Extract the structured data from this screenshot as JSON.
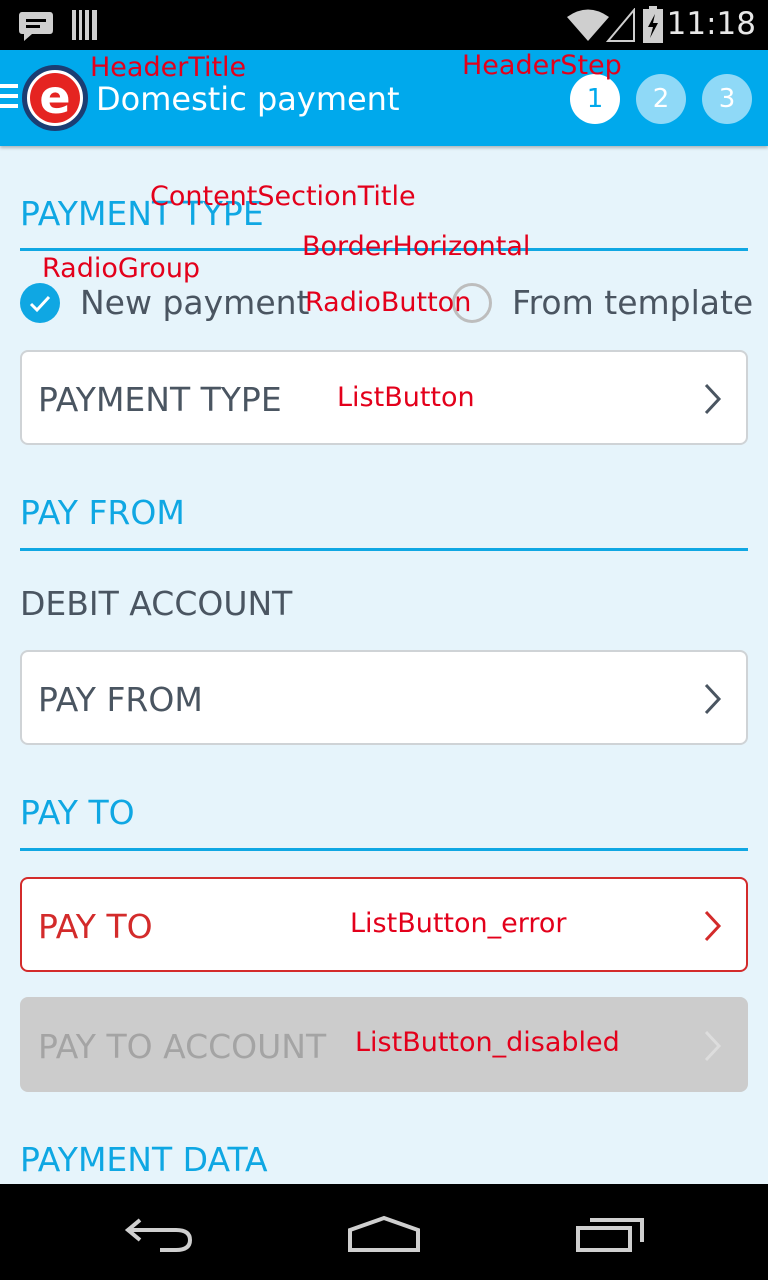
{
  "status_bar": {
    "time": "11:18",
    "icons": [
      "chat-icon",
      "barcode-icon",
      "wifi-icon",
      "signal-icon",
      "battery-icon"
    ]
  },
  "header": {
    "title": "Domestic payment",
    "logo_letter": "e",
    "steps": [
      "1",
      "2",
      "3"
    ],
    "active_step": "1"
  },
  "annotations": {
    "header_title": "HeaderTitle",
    "header_step": "HeaderStep",
    "content_section_title": "ContentSectionTitle",
    "border_horizontal": "BorderHorizontal",
    "radio_group": "RadioGroup",
    "radio_button": "RadioButton",
    "list_button": "ListButton",
    "list_button_error": "ListButton_error",
    "list_button_disabled": "ListButton_disabled"
  },
  "sections": {
    "payment_type": {
      "title": "PAYMENT TYPE",
      "radio_options": [
        "New payment",
        "From template"
      ],
      "selected": "New payment",
      "list_button": "PAYMENT TYPE"
    },
    "pay_from": {
      "title": "PAY FROM",
      "field_label": "DEBIT ACCOUNT",
      "list_button": "PAY FROM"
    },
    "pay_to": {
      "title": "PAY TO",
      "list_button_error": "PAY TO",
      "list_button_disabled": "PAY TO ACCOUNT"
    },
    "payment_data": {
      "title": "PAYMENT DATA"
    }
  },
  "colors": {
    "header_bg": "#00a9ec",
    "accent": "#0fa7e3",
    "error": "#d32b2b",
    "disabled_bg": "#cccccc",
    "annotation": "#e3001b",
    "page_bg": "#e6f4fb"
  },
  "nav_bar": {
    "icons": [
      "back-icon",
      "home-icon",
      "recents-icon"
    ]
  }
}
